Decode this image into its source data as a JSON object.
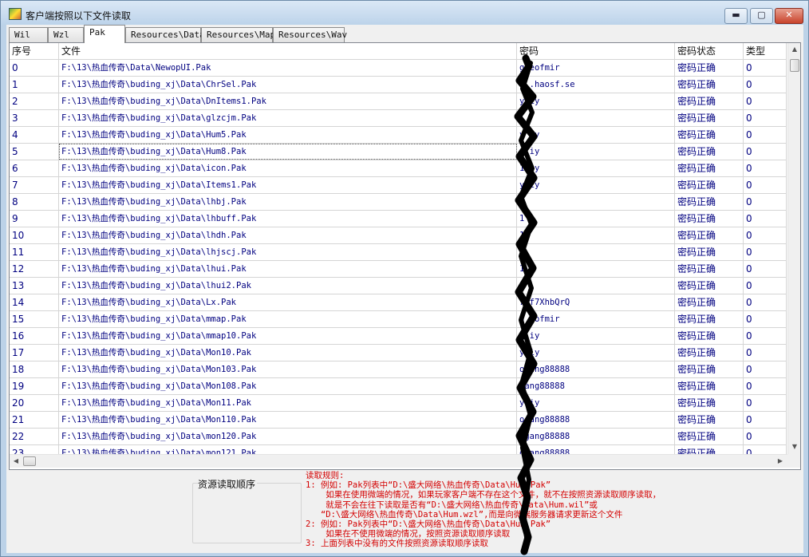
{
  "window": {
    "title": "客户端按照以下文件读取",
    "minimize_label": "▬",
    "maximize_label": "▢",
    "close_label": "✕"
  },
  "tabs": [
    "Wil",
    "Wzl",
    "Pak",
    "Resources\\Data",
    "Resources\\Map",
    "Resources\\Wav"
  ],
  "active_tab": "Pak",
  "table": {
    "columns": [
      "序号",
      "文件",
      "密码",
      "密码状态",
      "类型"
    ],
    "rows": [
      [
        "0",
        "F:\\13\\热血传奇\\Data\\NewopUI.Pak",
        "g  eofmir",
        "密码正确",
        "0"
      ],
      [
        "1",
        "F:\\13\\热血传奇\\buding_xj\\Data\\ChrSel.Pak",
        "w  .haosf.se",
        "密码正确",
        "0"
      ],
      [
        "2",
        "F:\\13\\热血传奇\\buding_xj\\Data\\DnItems1.Pak",
        "y  iy",
        "密码正确",
        "0"
      ],
      [
        "3",
        "F:\\13\\热血传奇\\buding_xj\\Data\\glzcjm.Pak",
        "1",
        "密码正确",
        "0"
      ],
      [
        "4",
        "F:\\13\\热血传奇\\buding_xj\\Data\\Hum5.Pak",
        "y  iy",
        "密码正确",
        "0"
      ],
      [
        "5",
        "F:\\13\\热血传奇\\buding_xj\\Data\\Hum8.Pak",
        "y  iy",
        "密码正确",
        "0"
      ],
      [
        "6",
        "F:\\13\\热血传奇\\buding_xj\\Data\\icon.Pak",
        "1  iy",
        "密码正确",
        "0"
      ],
      [
        "7",
        "F:\\13\\热血传奇\\buding_xj\\Data\\Items1.Pak",
        "y  iy",
        "密码正确",
        "0"
      ],
      [
        "8",
        "F:\\13\\热血传奇\\buding_xj\\Data\\lhbj.Pak",
        "1",
        "密码正确",
        "0"
      ],
      [
        "9",
        "F:\\13\\热血传奇\\buding_xj\\Data\\lhbuff.Pak",
        "1",
        "密码正确",
        "0"
      ],
      [
        "10",
        "F:\\13\\热血传奇\\buding_xj\\Data\\lhdh.Pak",
        "1",
        "密码正确",
        "0"
      ],
      [
        "11",
        "F:\\13\\热血传奇\\buding_xj\\Data\\lhjscj.Pak",
        "1",
        "密码正确",
        "0"
      ],
      [
        "12",
        "F:\\13\\热血传奇\\buding_xj\\Data\\lhui.Pak",
        "1",
        "密码正确",
        "0"
      ],
      [
        "13",
        "F:\\13\\热血传奇\\buding_xj\\Data\\lhui2.Pak",
        "1",
        "密码正确",
        "0"
      ],
      [
        "14",
        "F:\\13\\热血传奇\\buding_xj\\Data\\Lx.Pak",
        "7  f7XhbQrQ",
        "密码正确",
        "0"
      ],
      [
        "15",
        "F:\\13\\热血传奇\\buding_xj\\Data\\mmap.Pak",
        "g  eofmir",
        "密码正确",
        "0"
      ],
      [
        "16",
        "F:\\13\\热血传奇\\buding_xj\\Data\\mmap10.Pak",
        "y  iy",
        "密码正确",
        "0"
      ],
      [
        "17",
        "F:\\13\\热血传奇\\buding_xj\\Data\\Mon10.Pak",
        "y  iy",
        "密码正确",
        "0"
      ],
      [
        "18",
        "F:\\13\\热血传奇\\buding_xj\\Data\\Mon103.Pak",
        "   ogang88888",
        "密码正确",
        "0"
      ],
      [
        "19",
        "F:\\13\\热血传奇\\buding_xj\\Data\\Mon108.Pak",
        "   gang88888",
        "密码正确",
        "0"
      ],
      [
        "20",
        "F:\\13\\热血传奇\\buding_xj\\Data\\Mon11.Pak",
        "y  iy",
        "密码正确",
        "0"
      ],
      [
        "21",
        "F:\\13\\热血传奇\\buding_xj\\Data\\Mon110.Pak",
        "   ogang88888",
        "密码正确",
        "0"
      ],
      [
        "22",
        "F:\\13\\热血传奇\\buding_xj\\Data\\mon120.Pak",
        "   ogang88888",
        "密码正确",
        "0"
      ],
      [
        "23",
        "F:\\13\\热血传奇\\buding_xj\\Data\\mon121.Pak",
        "   ogang88888",
        "密码正确",
        "0"
      ]
    ],
    "selected_row": 5
  },
  "resource_order_label": "资源读取顺序",
  "rules": [
    "读取规则:",
    "1: 例如: Pak列表中“D:\\盛大网络\\热血传奇\\Data\\Hum.Pak”",
    "    如果在使用微端的情况，如果玩家客户端不存在这个文件，就不在按照资源读取顺序读取，",
    "    就是不会在往下读取是否有“D:\\盛大网络\\热血传奇\\Data\\Hum.wil”或",
    "   “D:\\盛大网络\\热血传奇\\Data\\Hum.wzl”,而是向微端服务器请求更新这个文件",
    "2: 例如: Pak列表中“D:\\盛大网络\\热血传奇\\Data\\Hum.Pak”",
    "    如果在不使用微端的情况，按照资源读取顺序读取",
    "3: 上面列表中没有的文件按照资源读取顺序读取"
  ],
  "colors": {
    "cell_text": "#000080",
    "rules_text": "#d40000",
    "scribble": "#000000"
  }
}
